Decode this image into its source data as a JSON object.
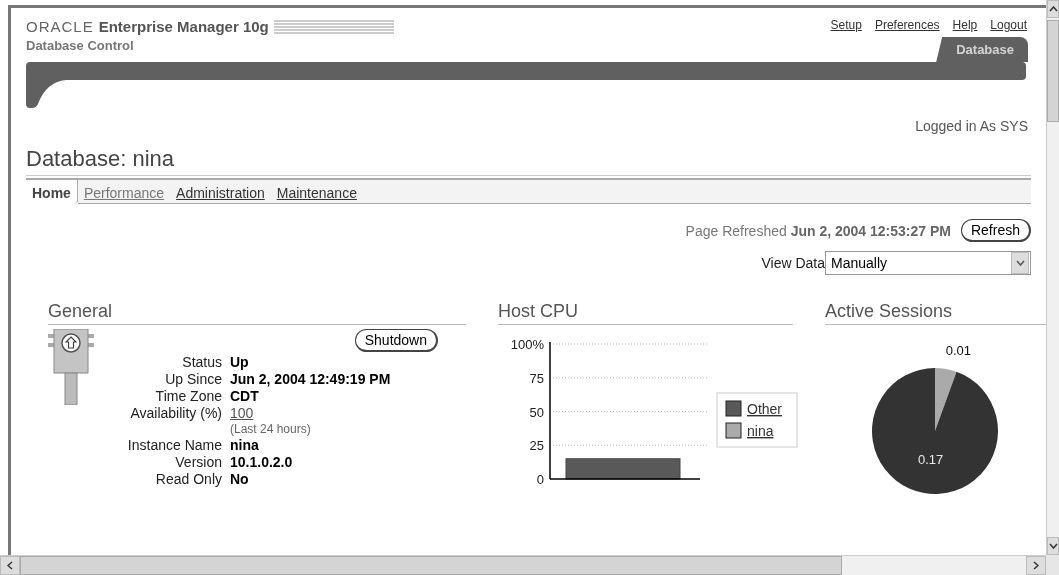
{
  "header": {
    "logo": "ORACLE",
    "product": "Enterprise Manager 10g",
    "subtitle": "Database Control",
    "global_links": [
      {
        "label": "Setup"
      },
      {
        "label": "Preferences"
      },
      {
        "label": "Help"
      },
      {
        "label": "Logout"
      }
    ],
    "tabs": [
      {
        "label": "Database",
        "selected": true
      }
    ]
  },
  "user_info": "Logged in As SYS",
  "page_title": "Database: nina",
  "subtabs": [
    {
      "label": "Home",
      "selected": true
    },
    {
      "label": "Performance",
      "selected": false
    },
    {
      "label": "Administration",
      "selected": false
    },
    {
      "label": "Maintenance",
      "selected": false
    }
  ],
  "refresh": {
    "label": "Page Refreshed",
    "time": "Jun 2, 2004 12:53:27 PM",
    "button": "Refresh"
  },
  "view_data": {
    "label": "View Data",
    "value": "Manually"
  },
  "general": {
    "title": "General",
    "button": "Shutdown",
    "rows": [
      {
        "label": "Status",
        "value": "Up",
        "kind": "text"
      },
      {
        "label": "Up Since",
        "value": "Jun 2, 2004 12:49:19 PM",
        "kind": "text"
      },
      {
        "label": "Time Zone",
        "value": "CDT",
        "kind": "text"
      },
      {
        "label": "Availability (%)",
        "value": "100",
        "kind": "link",
        "note": "(Last 24 hours)"
      },
      {
        "label": "Instance Name",
        "value": "nina",
        "kind": "text"
      },
      {
        "label": "Version",
        "value": "10.1.0.2.0",
        "kind": "text"
      },
      {
        "label": "Read Only",
        "value": "No",
        "kind": "text"
      }
    ]
  },
  "host_cpu": {
    "title": "Host CPU",
    "chart_data": {
      "type": "bar",
      "stacked": true,
      "grid": true,
      "yticks": [
        0,
        25,
        50,
        75,
        {
          "value": 100,
          "label": "100%"
        }
      ],
      "ylim": [
        0,
        100
      ],
      "series": [
        {
          "name": "Other",
          "color": "#595959",
          "values": [
            15
          ]
        },
        {
          "name": "nina",
          "color": "#aaaaaa",
          "values": [
            0
          ]
        }
      ]
    }
  },
  "active_sessions": {
    "title": "Active Sessions",
    "chart_data": {
      "type": "pie",
      "data_labels": true,
      "series": [
        {
          "values": [
            0.17,
            0.01
          ]
        }
      ],
      "colors": [
        "#333333",
        "#aaaaaa"
      ]
    }
  }
}
